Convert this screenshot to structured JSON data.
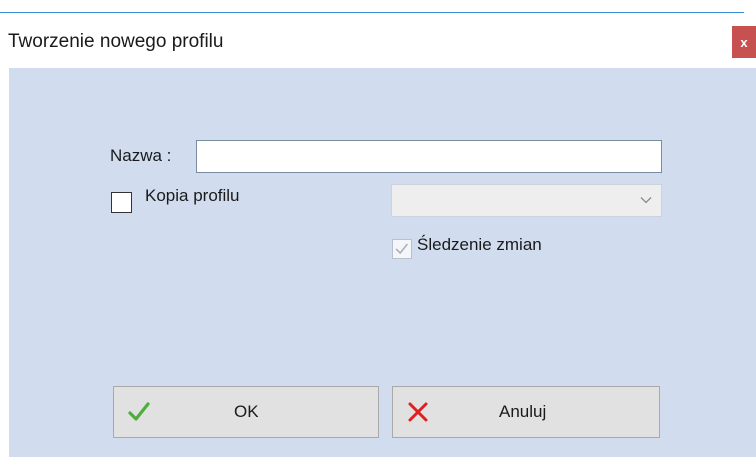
{
  "window": {
    "title": "Tworzenie nowego profilu",
    "close_label": "x"
  },
  "form": {
    "name_label": "Nazwa :",
    "name_value": "",
    "copy_profile": {
      "label": "Kopia profilu",
      "checked": false
    },
    "profile_select": {
      "value": "",
      "enabled": false
    },
    "track_changes": {
      "label": "Śledzenie zmian",
      "checked": true,
      "enabled": false
    }
  },
  "buttons": {
    "ok_label": "OK",
    "cancel_label": "Anuluj"
  },
  "icons": {
    "ok": "checkmark-icon",
    "cancel": "x-icon",
    "dropdown": "chevron-down-icon"
  },
  "colors": {
    "dialog_background": "#d1ddef",
    "close_button": "#c75050",
    "ok_icon": "#4caf3a",
    "cancel_icon": "#e02020"
  }
}
